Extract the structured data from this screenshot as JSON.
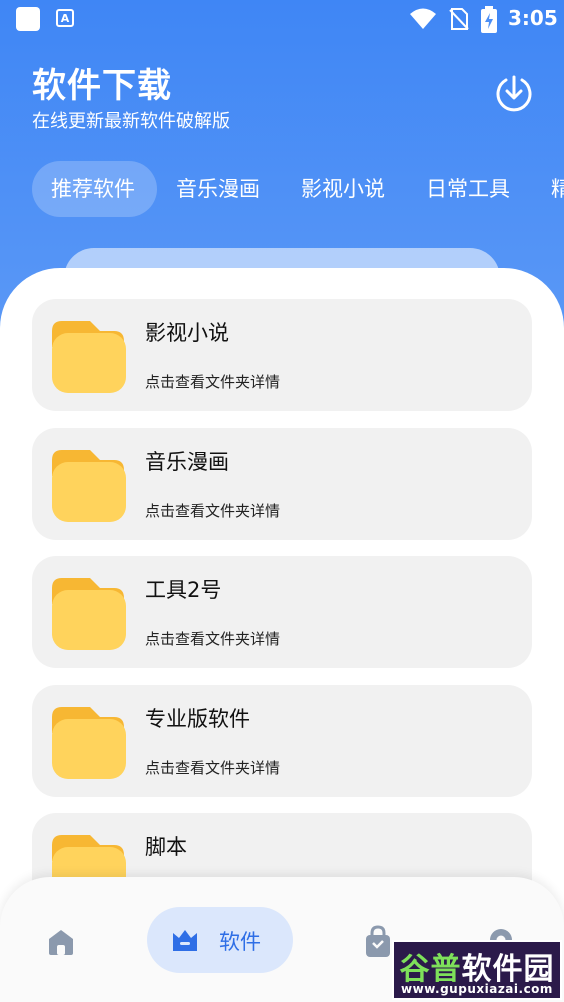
{
  "status_bar": {
    "time": "3:05",
    "a_badge": "A",
    "icons": [
      "app-square-icon",
      "a-badge-icon",
      "wifi-icon",
      "no-sim-icon",
      "battery-charging-icon"
    ]
  },
  "header": {
    "title": "软件下载",
    "subtitle": "在线更新最新软件破解版",
    "download_icon": "download-icon"
  },
  "tabs": [
    {
      "label": "推荐软件",
      "active": true
    },
    {
      "label": "音乐漫画",
      "active": false
    },
    {
      "label": "影视小说",
      "active": false
    },
    {
      "label": "日常工具",
      "active": false
    },
    {
      "label": "精",
      "active": false
    }
  ],
  "folders": [
    {
      "name": "影视小说",
      "desc": "点击查看文件夹详情"
    },
    {
      "name": "音乐漫画",
      "desc": "点击查看文件夹详情"
    },
    {
      "name": "工具2号",
      "desc": "点击查看文件夹详情"
    },
    {
      "name": "专业版软件",
      "desc": "点击查看文件夹详情"
    },
    {
      "name": "脚本",
      "desc": ""
    }
  ],
  "bottom_nav": {
    "software_label": "软件",
    "items": [
      "home-icon",
      "software-icon",
      "bag-icon",
      "gear-icon"
    ]
  },
  "watermark": {
    "main_a": "谷普",
    "main_b": "软件园",
    "url": "www.gupuxiazai.com"
  },
  "colors": {
    "header_blue": "#3f86f5",
    "accent": "#2e6ee6",
    "folder_yellow": "#ffd35c",
    "folder_tab": "#f7b733"
  }
}
